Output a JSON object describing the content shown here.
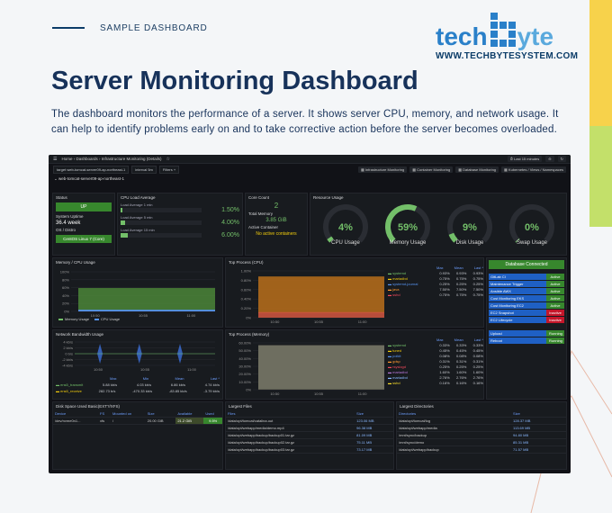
{
  "header": {
    "label": "SAMPLE DASHBOARD",
    "logo": {
      "part1": "tech",
      "part2": "yte"
    },
    "website": "WWW.TECHBYTESYSTEM.COM"
  },
  "title": "Server Monitoring Dashboard",
  "description": "The dashboard monitors the performance of a server. It shows server CPU, memory, and network usage. It can help to identify problems early on and to take corrective action before the server becomes overloaded.",
  "dashboard": {
    "breadcrumb": "Home › Dashboards › Infrastructure Monitoring (Details)",
    "time_range": "Last 15 minutes",
    "toolbar_buttons": [
      "Infrastructure Monitoring",
      "Container Monitoring",
      "Database Monitoring",
      "Kubernetes / Views / Namespaces"
    ],
    "filters": {
      "target_label": "target",
      "target_value": "web-tomcat-server09-ap-northeast-1",
      "interval_label": "interval",
      "interval_value": "5m",
      "filter_label": "Filters"
    },
    "host": "web-tomcat-server09-ap-northeast-1",
    "status": {
      "title": "Status",
      "value": "UP",
      "uptime_label": "System Uptime",
      "uptime_value": "36.4 week",
      "os_label": "OS / Distro",
      "os_value": "CentOS Linux 7 (Core)"
    },
    "cpu_load": {
      "title": "CPU Load Average",
      "items": [
        {
          "label": "Load Average 1 min",
          "value": "1.50%",
          "fill": 0.015
        },
        {
          "label": "Load Average 5 min",
          "value": "4.00%",
          "fill": 0.04
        },
        {
          "label": "Load Average 15 min",
          "value": "6.00%",
          "fill": 0.06
        }
      ]
    },
    "core": {
      "core_label": "Core Count",
      "core_value": "2",
      "mem_label": "Total Memory",
      "mem_value": "3.85 GiB",
      "container_label": "Active Container",
      "container_value": "No active containers"
    },
    "resource": {
      "title": "Resource Usage",
      "gauges": [
        {
          "label": "CPU Usage",
          "value": "4%",
          "pct": 4
        },
        {
          "label": "Memory Usage",
          "value": "59%",
          "pct": 59
        },
        {
          "label": "Disk Usage",
          "value": "9%",
          "pct": 9
        },
        {
          "label": "Swap Usage",
          "value": "0%",
          "pct": 0
        }
      ]
    },
    "memcpu": {
      "title": "Memory / CPU Usage",
      "yticks": [
        "100%",
        "80%",
        "60%",
        "40%",
        "20%",
        "0%"
      ],
      "xticks": [
        "10:50",
        "10:55",
        "11:00"
      ],
      "legend": [
        "Memory Usage",
        "CPU Usage"
      ]
    },
    "netbw": {
      "title": "Network Bandwidth Usage",
      "yticks": [
        "4 kb/s",
        "2 kb/s",
        "0 b/s",
        "-2 kb/s",
        "-4 kb/s"
      ],
      "xticks": [
        "10:50",
        "10:55",
        "11:00"
      ],
      "headers": [
        "Max",
        "Min",
        "Mean",
        "Last *"
      ],
      "rows": [
        {
          "name": "ens5_transmit",
          "vals": [
            "5.88 kb/s",
            "4.03 kb/s",
            "6.86 kb/s",
            "4.74 kb/s"
          ]
        },
        {
          "name": "ens5_receive",
          "vals": [
            "282.73 b/s",
            "-470.33 kb/s",
            "-83.85 kb/s",
            "-3.79 kb/s"
          ]
        }
      ]
    },
    "topcpu": {
      "title": "Top Process (CPU)",
      "yticks": [
        "1.00%",
        "0.80%",
        "0.60%",
        "0.40%",
        "0.20%",
        "0%"
      ],
      "xticks": [
        "10:50",
        "10:55",
        "11:00"
      ],
      "headers": [
        "Max",
        "Mean",
        "Last *"
      ],
      "rows": [
        {
          "name": "systemd",
          "vals": [
            "0.93%",
            "0.93%",
            "0.93%"
          ]
        },
        {
          "name": "mariadbd",
          "vals": [
            "0.75%",
            "0.75%",
            "0.75%"
          ]
        },
        {
          "name": "systemd-journal",
          "vals": [
            "0.25%",
            "0.25%",
            "0.25%"
          ]
        },
        {
          "name": "java",
          "vals": [
            "7.50%",
            "7.50%",
            "7.50%"
          ]
        },
        {
          "name": "sshd",
          "vals": [
            "0.75%",
            "0.75%",
            "0.75%"
          ]
        }
      ]
    },
    "topmem": {
      "title": "Top Process (Memory)",
      "yticks": [
        "60.00%",
        "50.00%",
        "40.00%",
        "30.00%",
        "20.00%",
        "10.00%",
        "0%"
      ],
      "xticks": [
        "10:50",
        "10:55",
        "11:00"
      ],
      "headers": [
        "Max",
        "Mean",
        "Last *"
      ],
      "rows": [
        {
          "name": "systemd",
          "vals": [
            "0.33%",
            "0.33%",
            "0.33%"
          ]
        },
        {
          "name": "tuned",
          "vals": [
            "0.45%",
            "0.45%",
            "0.45%"
          ]
        },
        {
          "name": "polkit",
          "vals": [
            "0.08%",
            "0.08%",
            "0.08%"
          ]
        },
        {
          "name": "gdsp",
          "vals": [
            "0.31%",
            "0.31%",
            "0.31%"
          ]
        },
        {
          "name": "rsyslogd",
          "vals": [
            "0.25%",
            "0.25%",
            "0.25%"
          ]
        },
        {
          "name": "mariadbd",
          "vals": [
            "1.60%",
            "1.60%",
            "1.60%"
          ]
        },
        {
          "name": "mariadbd",
          "vals": [
            "2.76%",
            "2.76%",
            "2.76%"
          ]
        },
        {
          "name": "sshd",
          "vals": [
            "0.16%",
            "0.16%",
            "0.16%"
          ]
        }
      ]
    },
    "db_connected": "Database Connected",
    "services": [
      {
        "name": "GitLab CI",
        "status": "Active"
      },
      {
        "name": "Maintenance Trigger",
        "status": "Active"
      },
      {
        "name": "Ansible AWX",
        "status": "Active"
      },
      {
        "name": "Cost Monitoring EKS",
        "status": "Active"
      },
      {
        "name": "Cost Monitoring EC2",
        "status": "Active"
      },
      {
        "name": "EC2 Snapshot",
        "status": "Inactive"
      },
      {
        "name": "EC2 Lifecycle",
        "status": "Inactive"
      }
    ],
    "services2": [
      {
        "name": "Upload",
        "status": "Running"
      },
      {
        "name": "Reboot",
        "status": "Running"
      }
    ],
    "disk": {
      "title": "Disk Space Used Basic(EXT?/XFS)",
      "headers": [
        "Device",
        "FS",
        "Mounted on",
        "Size",
        "Available",
        "Used"
      ],
      "row": [
        "/dev/nvme0n1...",
        "xfs",
        "/",
        "20.00 GiB",
        "21.2 GiB",
        "9.5%"
      ]
    },
    "largest_files": {
      "title": "Largest Files",
      "headers": [
        "Files",
        "Size"
      ],
      "rows": [
        [
          "/data/opt/tomcat/catalina.out",
          "123.06 MB"
        ],
        [
          "/data/opt/webapp/media/demo.mp4",
          "96.38 MB"
        ],
        [
          "/data/opt/webapp/backup/backup01.tar.gz",
          "81.09 MB"
        ],
        [
          "/data/opt/webapp/backup/backup02.tar.gz",
          "75.11 MB"
        ],
        [
          "/data/opt/webapp/backup/backup03.tar.gz",
          "73.17 MB"
        ]
      ]
    },
    "largest_dirs": {
      "title": "Largest Directories",
      "headers": [
        "Directories",
        "Size"
      ],
      "rows": [
        [
          "/data/opt/tomcat/log",
          "128.37 MB"
        ],
        [
          "/data/opt/webapp/media",
          "113.69 MB"
        ],
        [
          "/mnt/sync/backup",
          "94.80 MB"
        ],
        [
          "/mnt/sync/demo",
          "85.31 MB"
        ],
        [
          "/data/opt/webapp/backup",
          "71.57 MB"
        ]
      ]
    }
  }
}
